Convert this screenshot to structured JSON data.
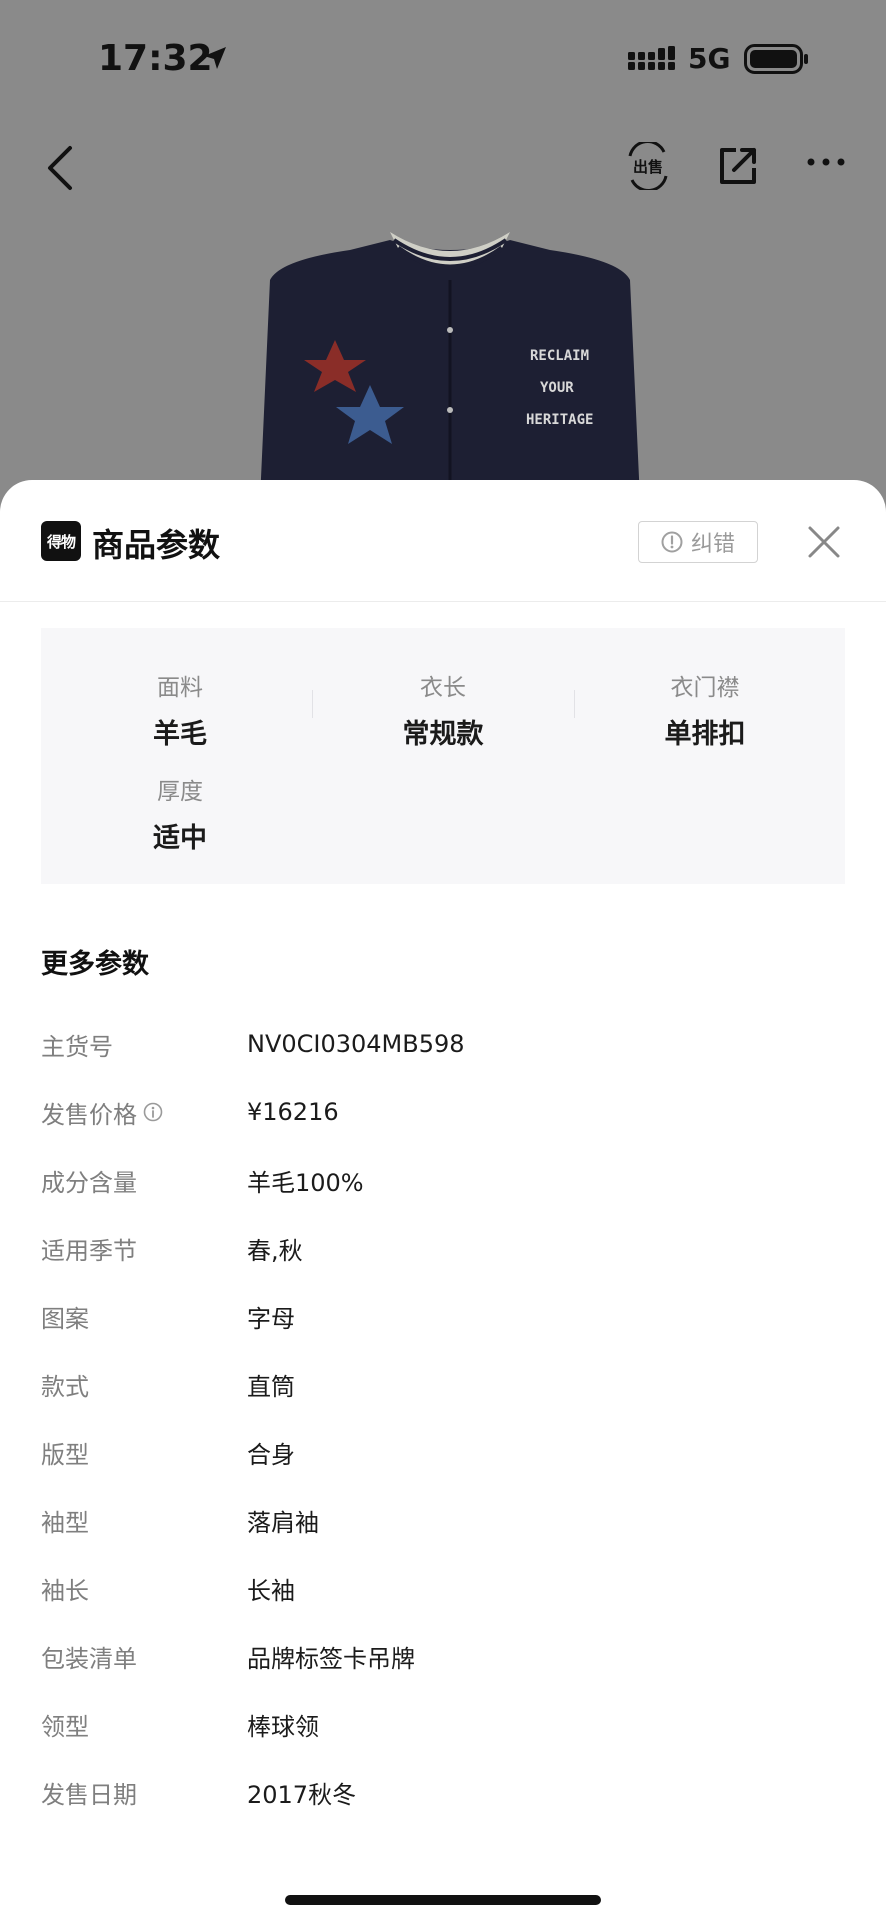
{
  "status_bar": {
    "time": "17:32",
    "network": "5G"
  },
  "nav": {
    "back_icon": "chevron-left-icon",
    "sell_icon": "sell-exchange-icon",
    "sell_label": "出售",
    "share_icon": "share-icon",
    "more_icon": "more-dots-icon"
  },
  "sheet": {
    "logo_text": "得物",
    "title": "商品参数",
    "report_label": "纠错",
    "close_icon": "close-icon",
    "summary": [
      {
        "label": "面料",
        "value": "羊毛"
      },
      {
        "label": "衣长",
        "value": "常规款"
      },
      {
        "label": "衣门襟",
        "value": "单排扣"
      },
      {
        "label": "厚度",
        "value": "适中"
      }
    ],
    "more_title": "更多参数",
    "params": [
      {
        "label": "主货号",
        "value": "NV0CI0304MB598",
        "info": false
      },
      {
        "label": "发售价格",
        "value": "¥16216",
        "info": true
      },
      {
        "label": "成分含量",
        "value": "羊毛100%",
        "info": false
      },
      {
        "label": "适用季节",
        "value": "春,秋",
        "info": false
      },
      {
        "label": "图案",
        "value": "字母",
        "info": false
      },
      {
        "label": "款式",
        "value": "直筒",
        "info": false
      },
      {
        "label": "版型",
        "value": "合身",
        "info": false
      },
      {
        "label": "袖型",
        "value": "落肩袖",
        "info": false
      },
      {
        "label": "袖长",
        "value": "长袖",
        "info": false
      },
      {
        "label": "包装清单",
        "value": "品牌标签卡吊牌",
        "info": false
      },
      {
        "label": "领型",
        "value": "棒球领",
        "info": false
      },
      {
        "label": "发售日期",
        "value": "2017秋冬",
        "info": false
      }
    ]
  },
  "product_image": {
    "patch_text": [
      "RECLAIM",
      "YOUR",
      "HERITAGE"
    ]
  },
  "colors": {
    "overlay": "#8a8a8a",
    "card_bg": "#f7f7f9",
    "label": "#7f7f7f",
    "text": "#1b1b1b"
  }
}
